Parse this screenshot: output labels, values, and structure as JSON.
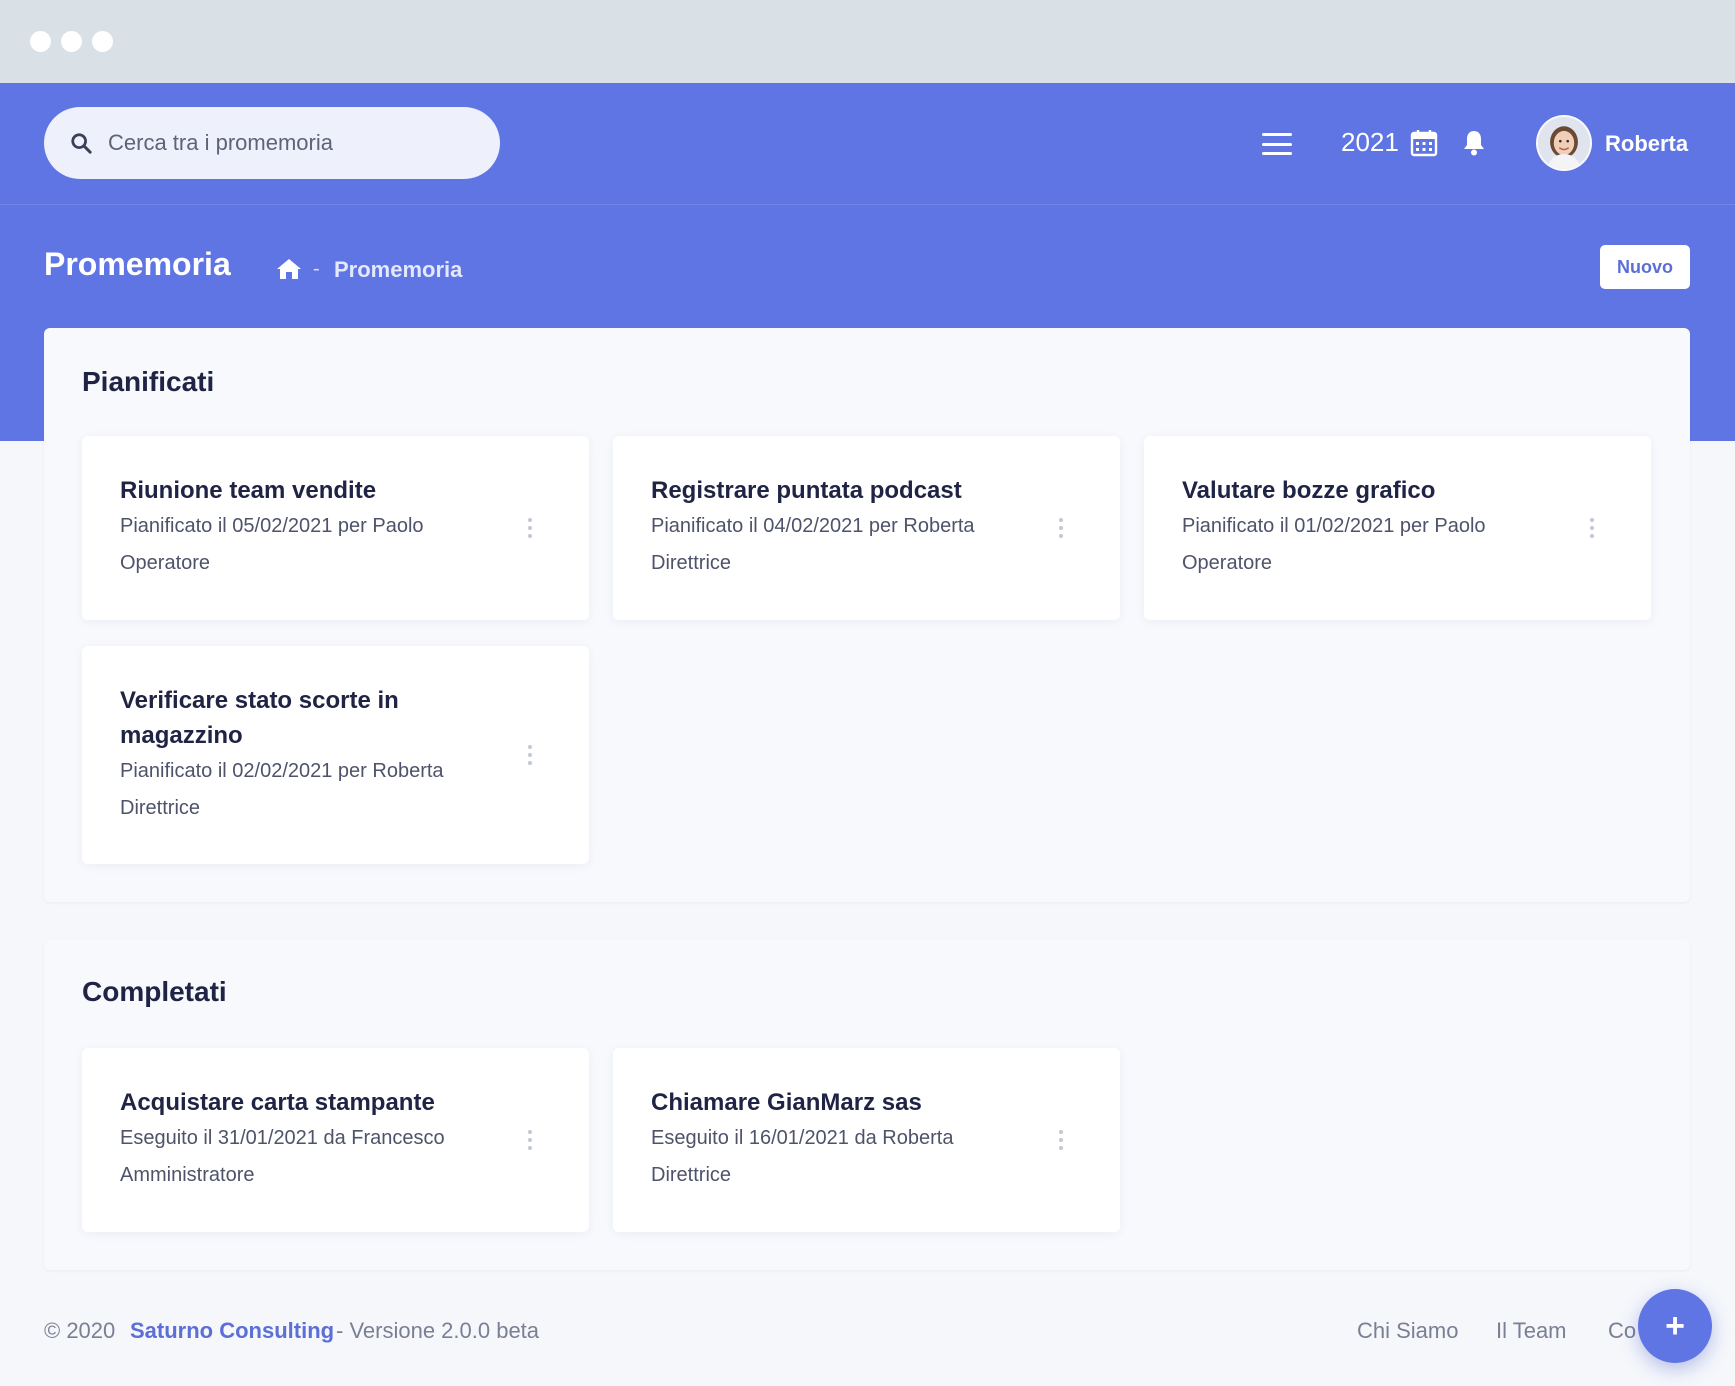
{
  "window": {
    "dots": [
      "close",
      "minimize",
      "maximize"
    ]
  },
  "header": {
    "search_placeholder": "Cerca tra i promemoria",
    "year": "2021",
    "username": "Roberta",
    "icons": [
      "search-icon",
      "menu-icon",
      "calendar-icon",
      "bell-icon",
      "avatar"
    ]
  },
  "page": {
    "title": "Promemoria",
    "breadcrumb_separator": "-",
    "breadcrumb_current": "Promemoria",
    "new_button": "Nuovo"
  },
  "planned": {
    "title": "Pianificati",
    "cards": [
      {
        "title": "Riunione team vendite",
        "meta": "Pianificato il 05/02/2021 per Paolo Operatore"
      },
      {
        "title": "Registrare puntata podcast",
        "meta": "Pianificato il 04/02/2021 per Roberta Direttrice"
      },
      {
        "title": "Valutare bozze grafico",
        "meta": "Pianificato il 01/02/2021 per Paolo Operatore"
      },
      {
        "title": "Verificare stato scorte in magazzino",
        "meta": "Pianificato il 02/02/2021 per Roberta Direttrice"
      }
    ]
  },
  "completed": {
    "title": "Completati",
    "cards": [
      {
        "title": "Acquistare carta stampante",
        "meta": "Eseguito il 31/01/2021 da Francesco Amministratore"
      },
      {
        "title": "Chiamare GianMarz sas",
        "meta": "Eseguito il 16/01/2021 da Roberta Direttrice"
      }
    ]
  },
  "footer": {
    "copyright": "© 2020",
    "brand": "Saturno Consulting",
    "version": "- Versione 2.0.0 beta",
    "links": [
      "Chi Siamo",
      "Il Team",
      "Co"
    ],
    "fab_label": "+"
  },
  "colors": {
    "primary": "#6075e4",
    "background": "#f5f7fb",
    "text": "#1f2344",
    "muted": "#4e536a"
  }
}
